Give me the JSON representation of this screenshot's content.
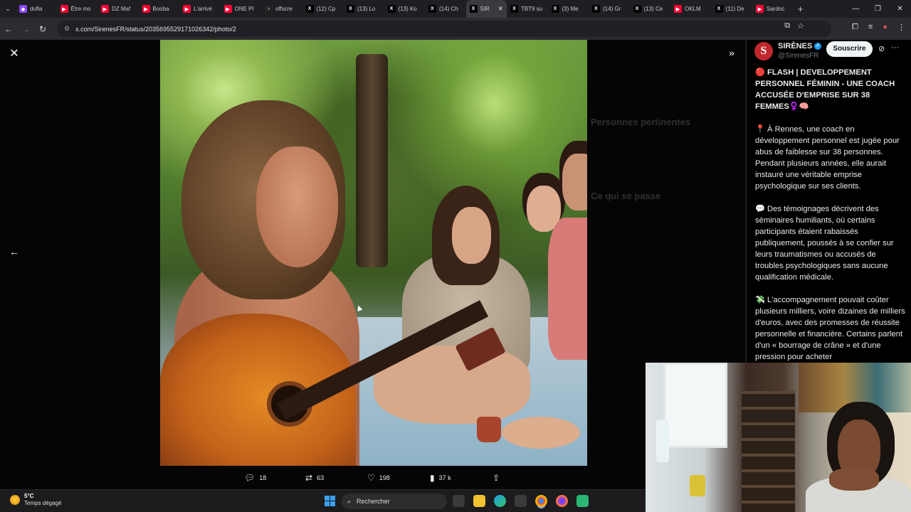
{
  "browser": {
    "tabs": [
      {
        "label": "dofla",
        "icon": "twitch-icon",
        "color": "#9146ff"
      },
      {
        "label": "Être mo",
        "icon": "youtube-icon",
        "color": "#ff0033"
      },
      {
        "label": "DZ Maf",
        "icon": "youtube-icon",
        "color": "#ff0033"
      },
      {
        "label": "Booba",
        "icon": "youtube-icon",
        "color": "#ff0033"
      },
      {
        "label": "L'arrivé",
        "icon": "youtube-icon",
        "color": "#ff0033"
      },
      {
        "label": "ONE PI",
        "icon": "youtube-icon",
        "color": "#ff0033"
      },
      {
        "label": "offscre",
        "icon": "tiktok-icon",
        "color": "#222"
      },
      {
        "label": "(12) Cp",
        "icon": "x-icon",
        "color": "#000"
      },
      {
        "label": "(13) Lo",
        "icon": "x-icon",
        "color": "#000"
      },
      {
        "label": "(13) Ko",
        "icon": "x-icon",
        "color": "#000"
      },
      {
        "label": "(14) Ch",
        "icon": "x-icon",
        "color": "#000"
      },
      {
        "label": "SIR",
        "icon": "x-icon",
        "color": "#000",
        "active": true
      },
      {
        "label": "TBT9 su",
        "icon": "x-icon",
        "color": "#000"
      },
      {
        "label": "(3) Me",
        "icon": "x-icon",
        "color": "#000"
      },
      {
        "label": "(14) Gr",
        "icon": "x-icon",
        "color": "#000"
      },
      {
        "label": "(13) Ce",
        "icon": "x-icon",
        "color": "#000"
      },
      {
        "label": "OKLM",
        "icon": "youtube-icon",
        "color": "#ff0033"
      },
      {
        "label": "(11) De",
        "icon": "x-icon",
        "color": "#000"
      },
      {
        "label": "Sardoc",
        "icon": "youtube-icon",
        "color": "#ff0033"
      }
    ],
    "url": "x.com/SirenesFR/status/2035695529171026342/photo/2"
  },
  "viewer": {
    "stats": {
      "replies": "18",
      "reposts": "63",
      "likes": "198",
      "views": "37 k"
    }
  },
  "background_panel": {
    "headings": [
      "Personnes pertinentes",
      "Ce qui se passe"
    ]
  },
  "tweet": {
    "author_name": "SIRÈNES",
    "author_handle": "@SirenesFR",
    "subscribe_label": "Souscrire",
    "avatar_letter": "S",
    "headline": "🔴 FLASH | DEVELOPPEMENT PERSONNEL FÉMININ - UNE COACH ACCUSÉE D'EMPRISE SUR 38 FEMMES♀️🧠",
    "para1": "📍 À Rennes, une coach en développement personnel est jugée pour abus de faiblesse sur 38 personnes. Pendant plusieurs années, elle aurait instauré une véritable emprise psychologique sur ses clients.",
    "para2": "💬 Des témoignages décrivent des séminaires humiliants, où certains participants étaient rabaissés publiquement, poussés à se confier sur leurs traumatismes ou accusés de troubles psychologiques sans aucune qualification médicale.",
    "para3": "💸 L'accompagnement pouvait coûter plusieurs milliers, voire dizaines de milliers d'euros, avec des promesses de réussite personnelle et financière. Certains parlent d'un « bourrage de crâne » et d'une pression pour acheter"
  },
  "taskbar": {
    "temperature": "5°C",
    "weather": "Temps dégagé",
    "search_placeholder": "Rechercher"
  }
}
